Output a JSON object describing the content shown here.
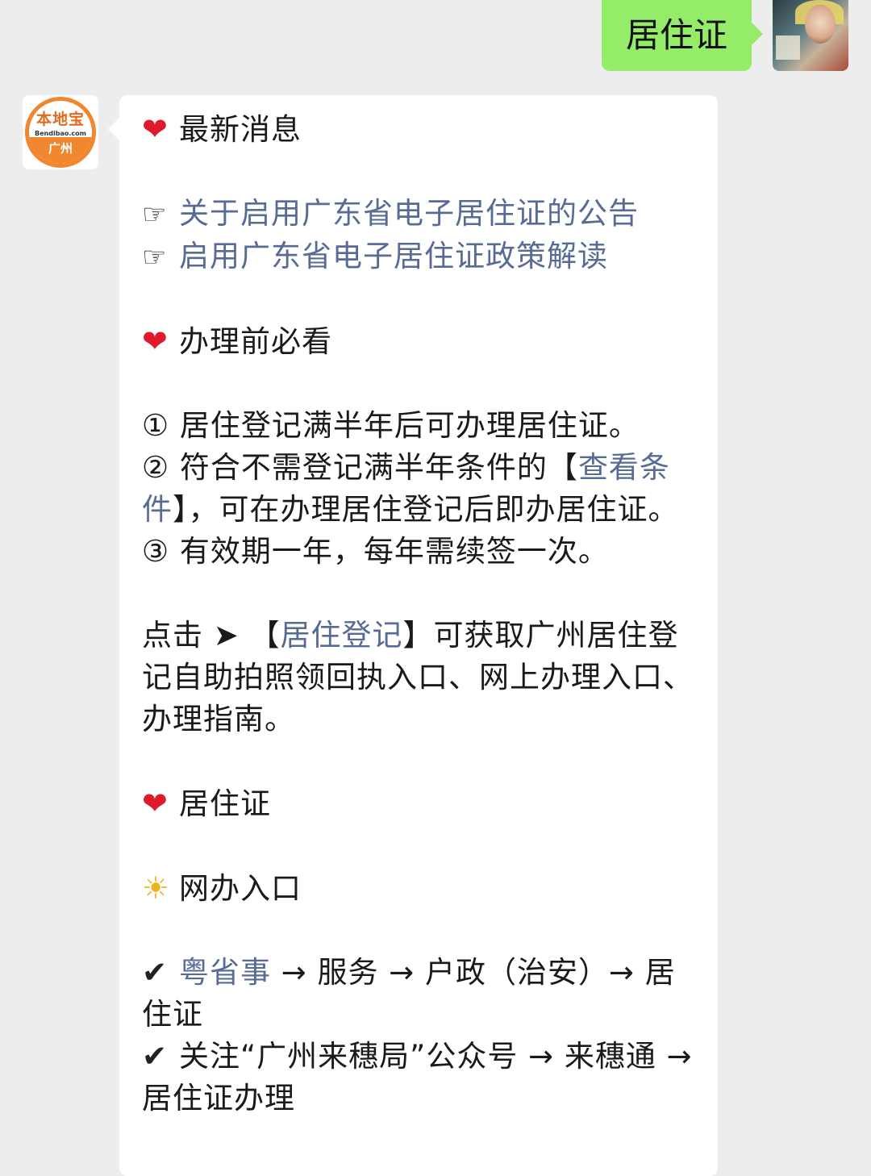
{
  "outgoing": {
    "text": "居住证"
  },
  "bot_logo": {
    "top": "本地宝",
    "mid": "Bendibao.com",
    "bottom": "广州"
  },
  "message": {
    "heart": "❤",
    "hand": "☞",
    "check": "✔",
    "sun": "☀",
    "news_heading": "最新消息",
    "news_link_1": "关于启用广东省电子居住证的公告",
    "news_link_2": "启用广东省电子居住证政策解读",
    "prep_heading": "办理前必看",
    "item1": "① 居住登记满半年后可办理居住证。",
    "item2_a": "② 符合不需登记满半年条件的【",
    "item2_link": "查看条件",
    "item2_b": "】，可在办理居住登记后即办居住证。",
    "item3": "③ 有效期一年，每年需续签一次。",
    "click_a": "点击 ➤ 【",
    "click_link": "居住登记",
    "click_b": "】可获取广州居住登记自助拍照领回执入口、网上办理入口、办理指南。",
    "permit_heading": "居住证",
    "online_heading": "网办入口",
    "online1_link": "粤省事",
    "online1_rest": " → 服务 → 户政（治安）→ 居住证",
    "online2": "关注“广州来穗局”公众号 → 来穗通 → 居住证办理"
  },
  "colors": {
    "link": "#576b95",
    "bubble_out": "#95ec69",
    "heart": "#e0192b"
  }
}
